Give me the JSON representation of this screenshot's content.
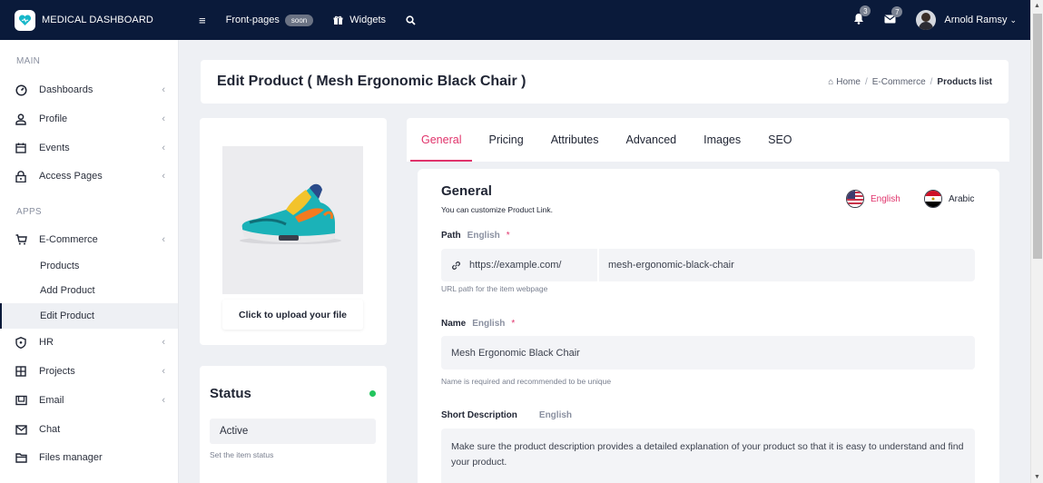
{
  "app": {
    "title": "MEDICAL DASHBOARD"
  },
  "topnav": {
    "front_pages": "Front-pages",
    "soon_badge": "soon",
    "widgets": "Widgets",
    "notifications_count": "3",
    "messages_count": "7",
    "user_name": "Arnold Ramsy"
  },
  "sidebar": {
    "section_main": "MAIN",
    "section_apps": "APPS",
    "items": [
      {
        "label": "Dashboards"
      },
      {
        "label": "Profile"
      },
      {
        "label": "Events"
      },
      {
        "label": "Access Pages"
      },
      {
        "label": "E-Commerce"
      },
      {
        "label": "HR"
      },
      {
        "label": "Projects"
      },
      {
        "label": "Email"
      },
      {
        "label": "Chat"
      },
      {
        "label": "Files manager"
      }
    ],
    "ecommerce_sub": [
      {
        "label": "Products"
      },
      {
        "label": "Add Product"
      },
      {
        "label": "Edit Product"
      }
    ]
  },
  "page": {
    "title": "Edit Product ( Mesh Ergonomic Black Chair )",
    "breadcrumb": {
      "home": "Home",
      "ecommerce": "E-Commerce",
      "current": "Products list"
    }
  },
  "upload": {
    "label": "Click to upload your file"
  },
  "status": {
    "title": "Status",
    "value": "Active",
    "help": "Set the item status",
    "color": "#22c55e"
  },
  "tabs": [
    "General",
    "Pricing",
    "Attributes",
    "Advanced",
    "Images",
    "SEO"
  ],
  "form": {
    "title": "General",
    "subtitle": "You can customize Product Link.",
    "languages": {
      "english": "English",
      "arabic": "Arabic"
    },
    "path": {
      "label": "Path",
      "lang": "English",
      "required_mark": "*",
      "prefix": "https://example.com/",
      "value": "mesh-ergonomic-black-chair",
      "help": "URL path for the item webpage"
    },
    "name": {
      "label": "Name",
      "lang": "English",
      "required_mark": "*",
      "value": "Mesh Ergonomic Black Chair",
      "help": "Name is required and recommended to be unique"
    },
    "short_description": {
      "label": "Short Description",
      "lang": "English",
      "value": "Make sure the product description provides a detailed explanation of your product so that it is easy to understand and find your product."
    }
  },
  "colors": {
    "topbar": "#0a1a3a",
    "accent": "#e0336b",
    "page_bg": "#eef0f4"
  }
}
